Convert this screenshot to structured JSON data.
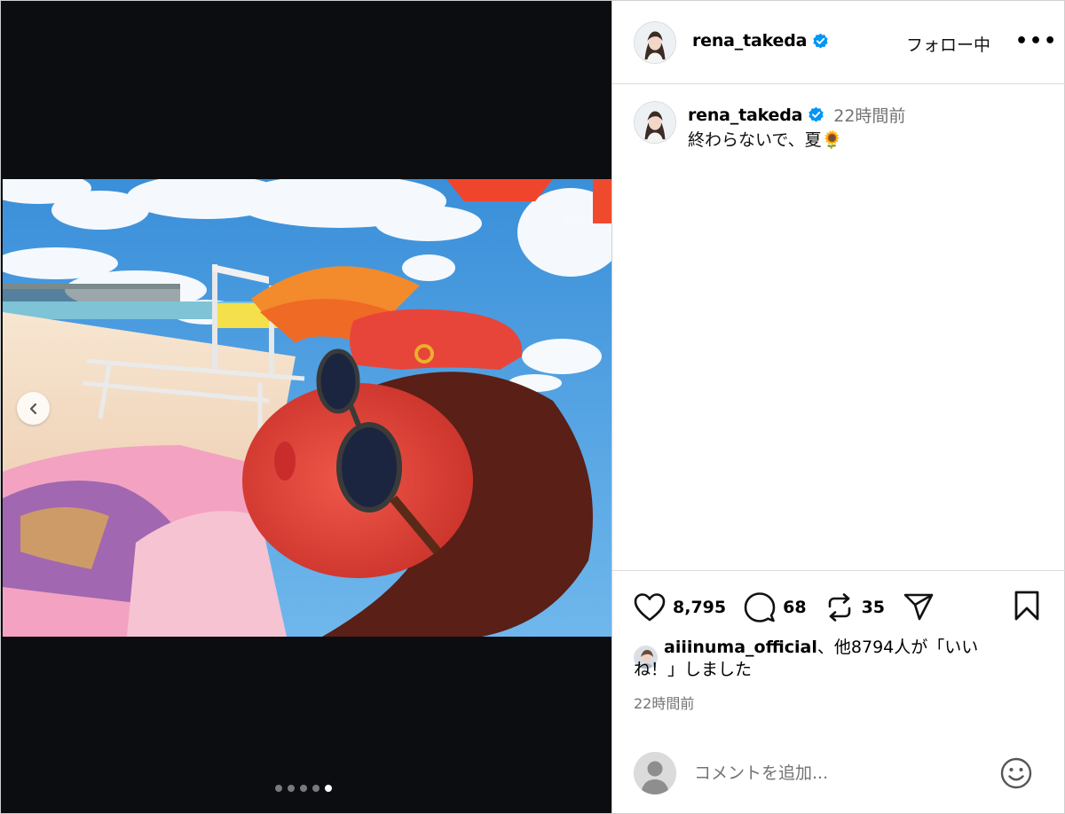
{
  "post": {
    "username": "rena_takeda",
    "follow_label": "フォロー中",
    "more_label": "•••",
    "time_ago": "22時間前",
    "caption": "終わらないで、夏🌻",
    "likes_count": "8,795",
    "comments_count": "68",
    "reposts_count": "35",
    "liked_by_user": "aiiinuma_official",
    "liked_by_rest": "、他8794人が「いい",
    "liked_by_line2": "ね！」しました",
    "timestamp": "22時間前"
  },
  "carousel": {
    "total": 5,
    "active_index": 4
  },
  "comment": {
    "placeholder": "コメントを追加..."
  },
  "colors": {
    "verified": "#0095f6",
    "muted": "#737373",
    "media_bg": "#0b0d11"
  },
  "icons": [
    "verified-badge-icon",
    "chevron-left-icon",
    "heart-icon",
    "comment-icon",
    "repost-icon",
    "share-icon",
    "bookmark-icon",
    "emoji-icon",
    "default-avatar-icon"
  ]
}
